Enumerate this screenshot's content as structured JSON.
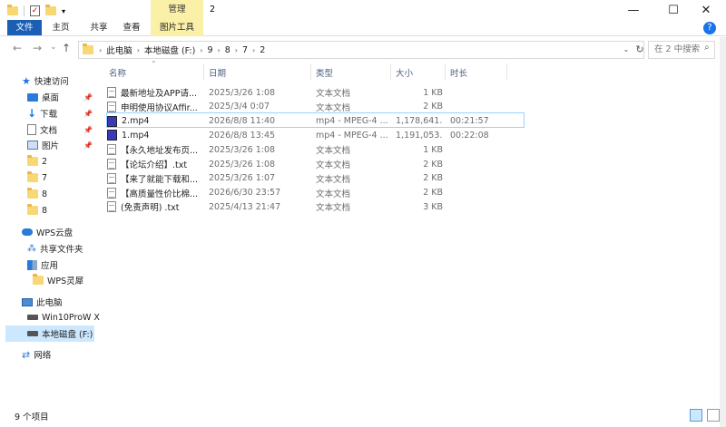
{
  "window": {
    "title": "2",
    "manage_tab": "管理",
    "min_glyph": "—",
    "max_glyph": "☐",
    "close_glyph": "✕"
  },
  "ribbon": {
    "tabs": [
      "文件",
      "主页",
      "共享",
      "查看"
    ],
    "picture_tools": "图片工具",
    "help_glyph": "?"
  },
  "nav": {
    "back": "←",
    "forward": "→",
    "recent": "⌄",
    "up": "↑",
    "breadcrumb": [
      "此电脑",
      "本地磁盘 (F:)",
      "9",
      "8",
      "7",
      "2"
    ],
    "sep": "›",
    "dropdown": "⌄",
    "refresh": "↻",
    "search_placeholder": "在 2 中搜索",
    "search_glyph": "⌕"
  },
  "sidebar": {
    "quick_access": "快速访问",
    "pin_glyph": "📌",
    "items": [
      {
        "label": "桌面",
        "icon": "desktop-icon"
      },
      {
        "label": "下载",
        "icon": "download-icon"
      },
      {
        "label": "文档",
        "icon": "document-icon"
      },
      {
        "label": "图片",
        "icon": "picture-icon"
      }
    ],
    "folders": [
      "2",
      "7",
      "8",
      "8"
    ],
    "wps_cloud": "WPS云盘",
    "shared_folder": "共享文件夹",
    "app": "应用",
    "wps_lingxi": "WPS灵犀",
    "this_pc": "此电脑",
    "drive_c": "Win10ProW X",
    "drive_f": "本地磁盘 (F:)",
    "network": "网络"
  },
  "columns": {
    "name": "名称",
    "date": "日期",
    "type": "类型",
    "size": "大小",
    "duration": "时长"
  },
  "files": [
    {
      "name": "最新地址及APP请...",
      "date": "2025/3/26 1:08",
      "type": "文本文档",
      "size": "1 KB",
      "duration": "",
      "icon": "txt"
    },
    {
      "name": "申明使用协议Affir...",
      "date": "2025/3/4 0:07",
      "type": "文本文档",
      "size": "2 KB",
      "duration": "",
      "icon": "txt"
    },
    {
      "name": "2.mp4",
      "date": "2026/8/8 11:40",
      "type": "mp4 - MPEG-4 ...",
      "size": "1,178,641...",
      "duration": "00:21:57",
      "icon": "mp4"
    },
    {
      "name": "1.mp4",
      "date": "2026/8/8 13:45",
      "type": "mp4 - MPEG-4 ...",
      "size": "1,191,053...",
      "duration": "00:22:08",
      "icon": "mp4"
    },
    {
      "name": "【永久地址发布页...",
      "date": "2025/3/26 1:08",
      "type": "文本文档",
      "size": "1 KB",
      "duration": "",
      "icon": "txt"
    },
    {
      "name": "【论坛介绍】.txt",
      "date": "2025/3/26 1:08",
      "type": "文本文档",
      "size": "2 KB",
      "duration": "",
      "icon": "txt"
    },
    {
      "name": "【来了就能下载和...",
      "date": "2025/3/26 1:07",
      "type": "文本文档",
      "size": "2 KB",
      "duration": "",
      "icon": "txt"
    },
    {
      "name": "【高质量性价比棉...",
      "date": "2026/6/30 23:57",
      "type": "文本文档",
      "size": "2 KB",
      "duration": "",
      "icon": "txt"
    },
    {
      "name": "(免责声明) .txt",
      "date": "2025/4/13 21:47",
      "type": "文本文档",
      "size": "3 KB",
      "duration": "",
      "icon": "txt"
    }
  ],
  "status": {
    "count": "9 个项目"
  }
}
